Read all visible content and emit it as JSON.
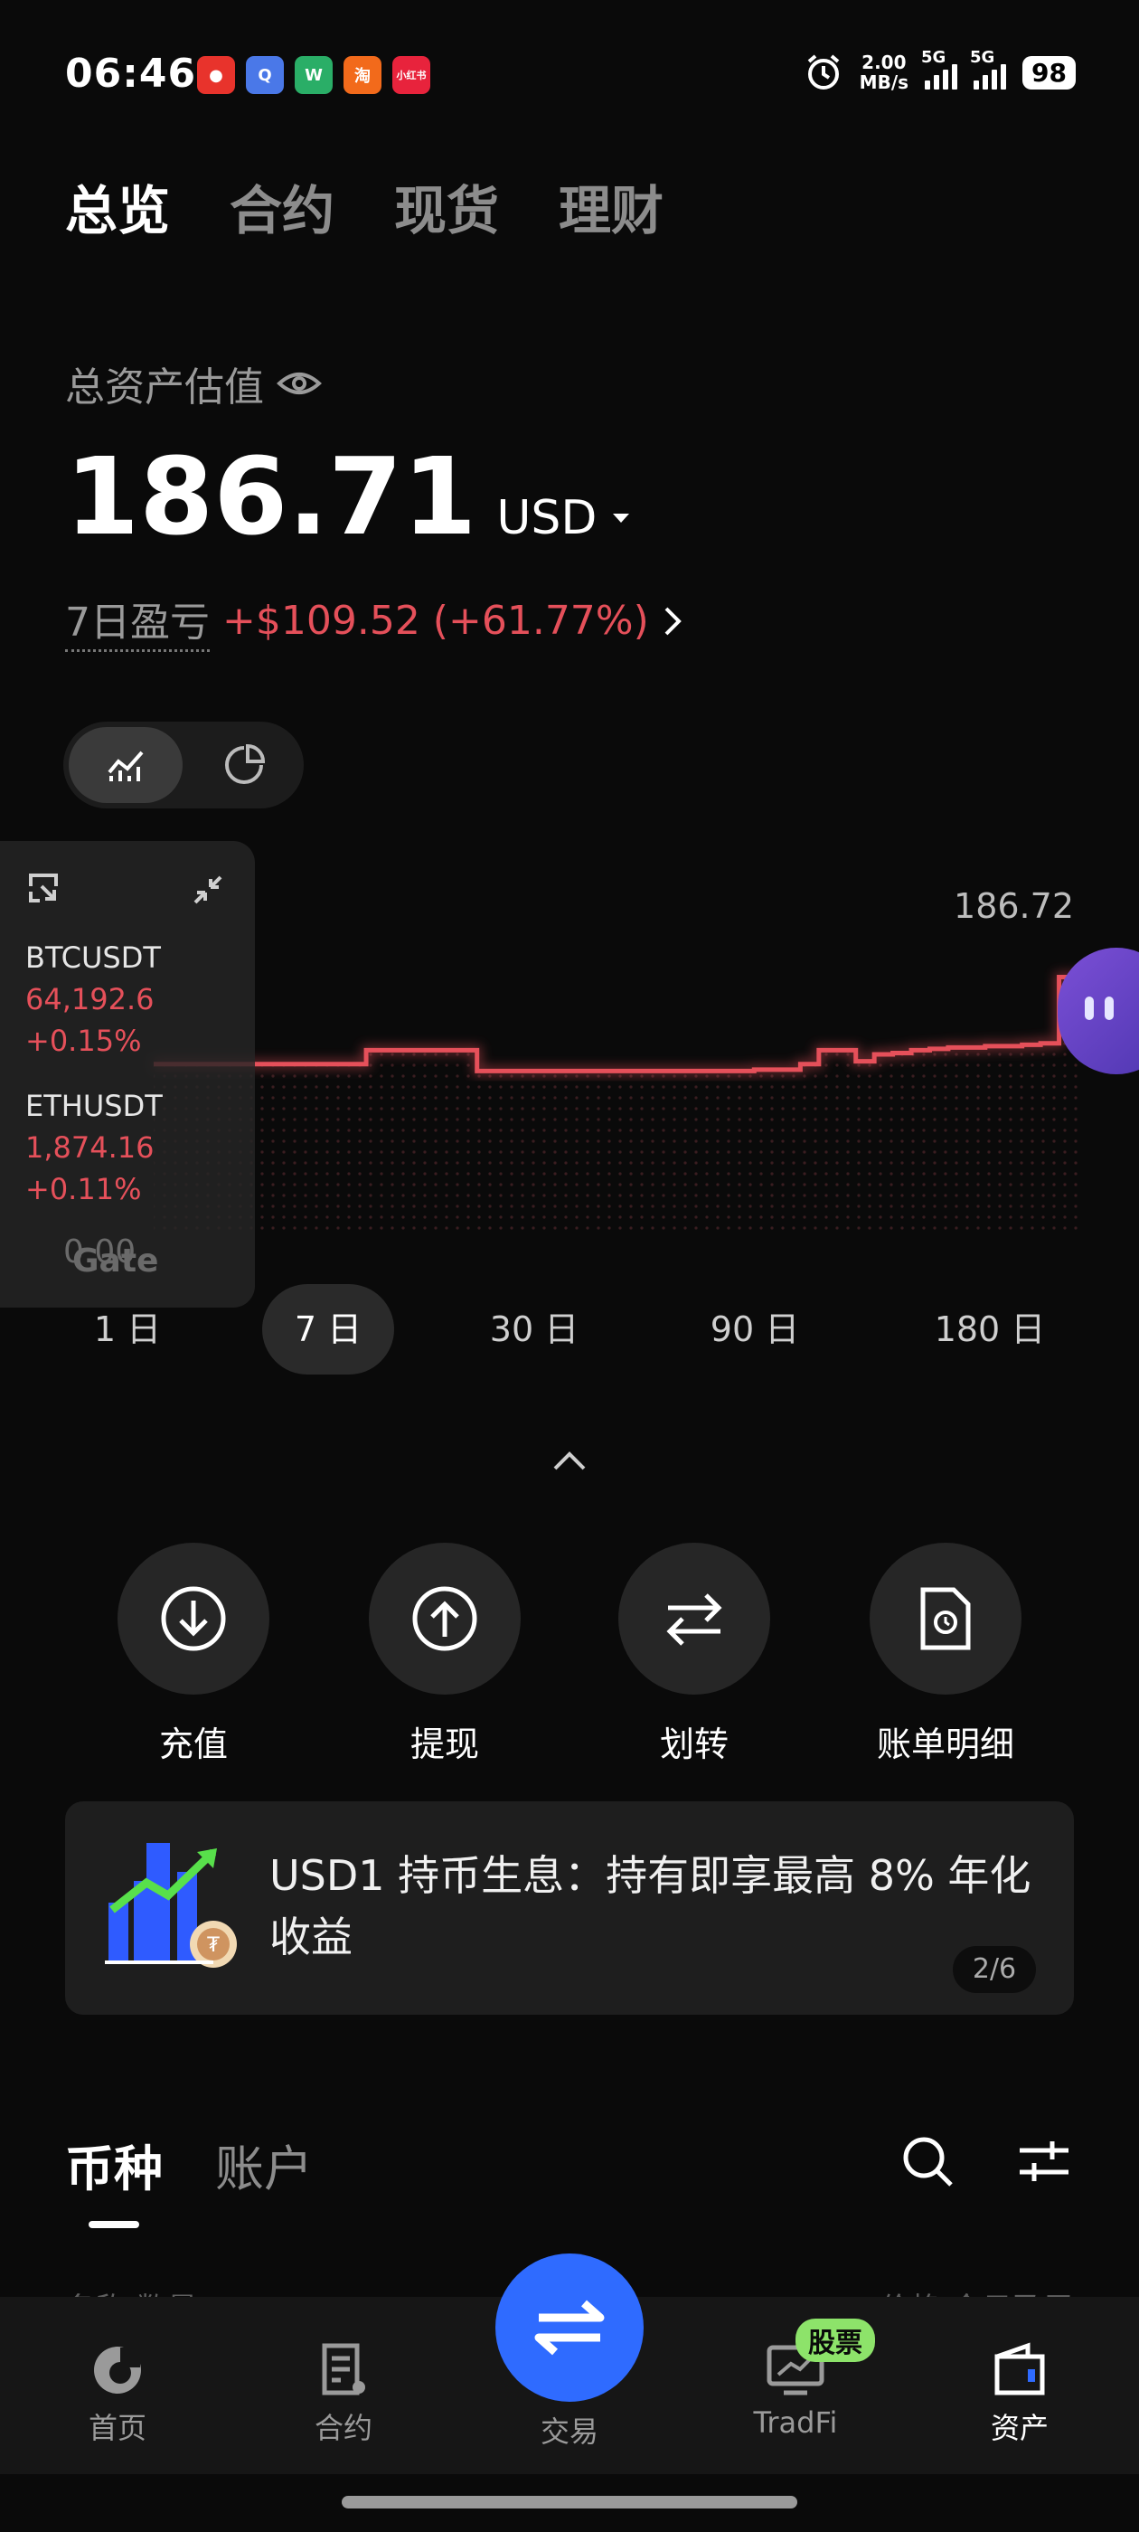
{
  "status_bar": {
    "time": "06:46",
    "app_icons": [
      {
        "name": "app-icon-1",
        "color": "#e8332c",
        "text": "●"
      },
      {
        "name": "app-icon-2",
        "color": "#4a78e8",
        "text": "Q"
      },
      {
        "name": "wechat-icon",
        "color": "#2aae67",
        "text": "W"
      },
      {
        "name": "taobao-icon",
        "color": "#f26a1b",
        "text": "淘"
      },
      {
        "name": "xiaohongshu-icon",
        "color": "#e8233c",
        "text": "小红书"
      }
    ],
    "net_speed_value": "2.00",
    "net_speed_unit": "MB/s",
    "signal_1": "5G",
    "signal_2": "5G",
    "battery": "98"
  },
  "top_tabs": [
    "总览",
    "合约",
    "现货",
    "理财"
  ],
  "assets": {
    "label": "总资产估值",
    "total": "186.71",
    "currency": "USD",
    "pnl_label": "7日盈亏",
    "pnl_value": "+$109.52 (+61.77%)"
  },
  "chart_data": {
    "type": "line",
    "title": "",
    "x": [
      0,
      0.1,
      0.2,
      0.23,
      0.26,
      0.3,
      0.33,
      0.35,
      0.4,
      0.45,
      0.5,
      0.55,
      0.6,
      0.65,
      0.7,
      0.72,
      0.74,
      0.76,
      0.78,
      0.8,
      0.82,
      0.84,
      0.86,
      0.88,
      0.9,
      0.92,
      0.94,
      0.96,
      0.98,
      1.0
    ],
    "values": [
      120,
      120,
      120,
      130,
      130,
      130,
      130,
      115,
      115,
      115,
      115,
      115,
      115,
      116,
      120,
      130,
      130,
      122,
      127,
      128,
      130,
      131,
      132,
      132,
      133,
      133,
      134,
      135,
      183,
      186.72
    ],
    "y_max_label": "186.72",
    "y_min_label": "0.00",
    "watermark": "Gate",
    "line_color": "#e5505a"
  },
  "periods": [
    "1 日",
    "7 日",
    "30 日",
    "90 日",
    "180 日"
  ],
  "active_period": "7 日",
  "ticker_widget": {
    "tickers": [
      {
        "symbol": "BTCUSDT",
        "price": "64,192.6",
        "change": "+0.15%"
      },
      {
        "symbol": "ETHUSDT",
        "price": "1,874.16",
        "change": "+0.11%"
      }
    ]
  },
  "actions": [
    "充值",
    "提现",
    "划转",
    "账单明细"
  ],
  "banner": {
    "text": "USD1 持币生息：持有即享最高 8% 年化收益",
    "page": "2/6"
  },
  "bottom_tabs": [
    "币种",
    "账户"
  ],
  "list_header_left": "名称 数量",
  "list_header_right": "价格 今日盈亏",
  "nav": [
    "首页",
    "合约",
    "交易",
    "TradFi",
    "资产"
  ],
  "tradfi_badge": "股票",
  "colors": {
    "red": "#e5505a",
    "blue": "#2f6bff",
    "bg": "#0a0a0a"
  }
}
